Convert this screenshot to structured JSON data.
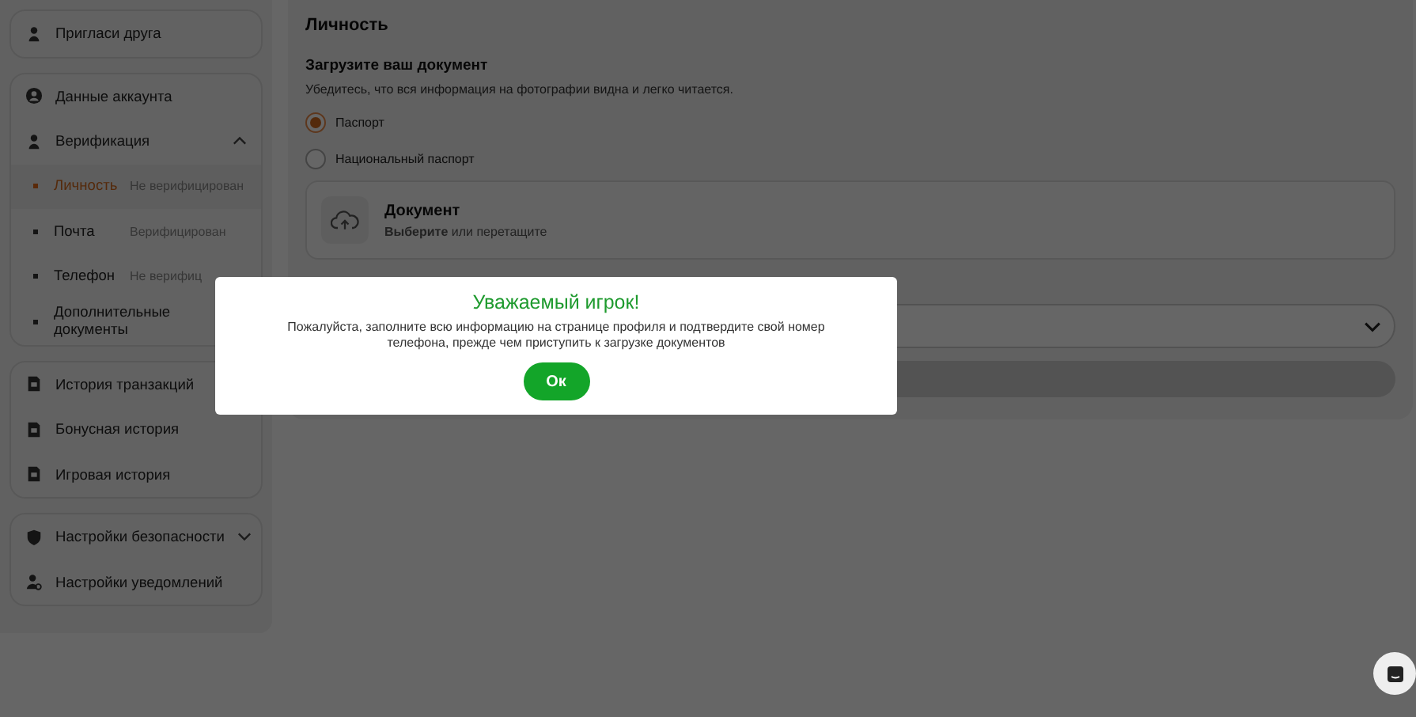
{
  "sidebar": {
    "groups": [
      {
        "items": [
          {
            "label": "Пригласи друга"
          }
        ]
      },
      {
        "items": [
          {
            "label": "Данные аккаунта"
          },
          {
            "label": "Верификация",
            "expanded": true,
            "children": [
              {
                "label": "Личность",
                "status": "Не верифицирован",
                "selected": true
              },
              {
                "label": "Почта",
                "status": "Верифицирован",
                "selected": false
              },
              {
                "label": "Телефон",
                "status": "Не верифиц",
                "selected": false
              },
              {
                "label": "Дополнительные документы",
                "selected": false
              }
            ]
          }
        ]
      },
      {
        "items": [
          {
            "label": "История транзакций"
          },
          {
            "label": "Бонусная история"
          },
          {
            "label": "Игровая история"
          }
        ]
      },
      {
        "items": [
          {
            "label": "Настройки безопасности",
            "expanded": false
          },
          {
            "label": "Настройки уведомлений"
          }
        ]
      }
    ]
  },
  "main": {
    "title": "Личность",
    "heading": "Загрузите ваш документ",
    "subtitle": "Убедитесь, что вся информация на фотографии видна и легко читается.",
    "options": [
      {
        "label": "Паспорт",
        "selected": true
      },
      {
        "label": "Национальный паспорт",
        "selected": false
      }
    ],
    "upload": {
      "title": "Документ",
      "hint": "**Выберите** или перетащите"
    }
  },
  "modal": {
    "title": "Уважаемый игрок!",
    "message": "Пожалуйста, заполните всю информацию на странице профиля и подтвердите свой номер телефона, прежде чем приступить к загрузке документов",
    "button": "Ок"
  }
}
